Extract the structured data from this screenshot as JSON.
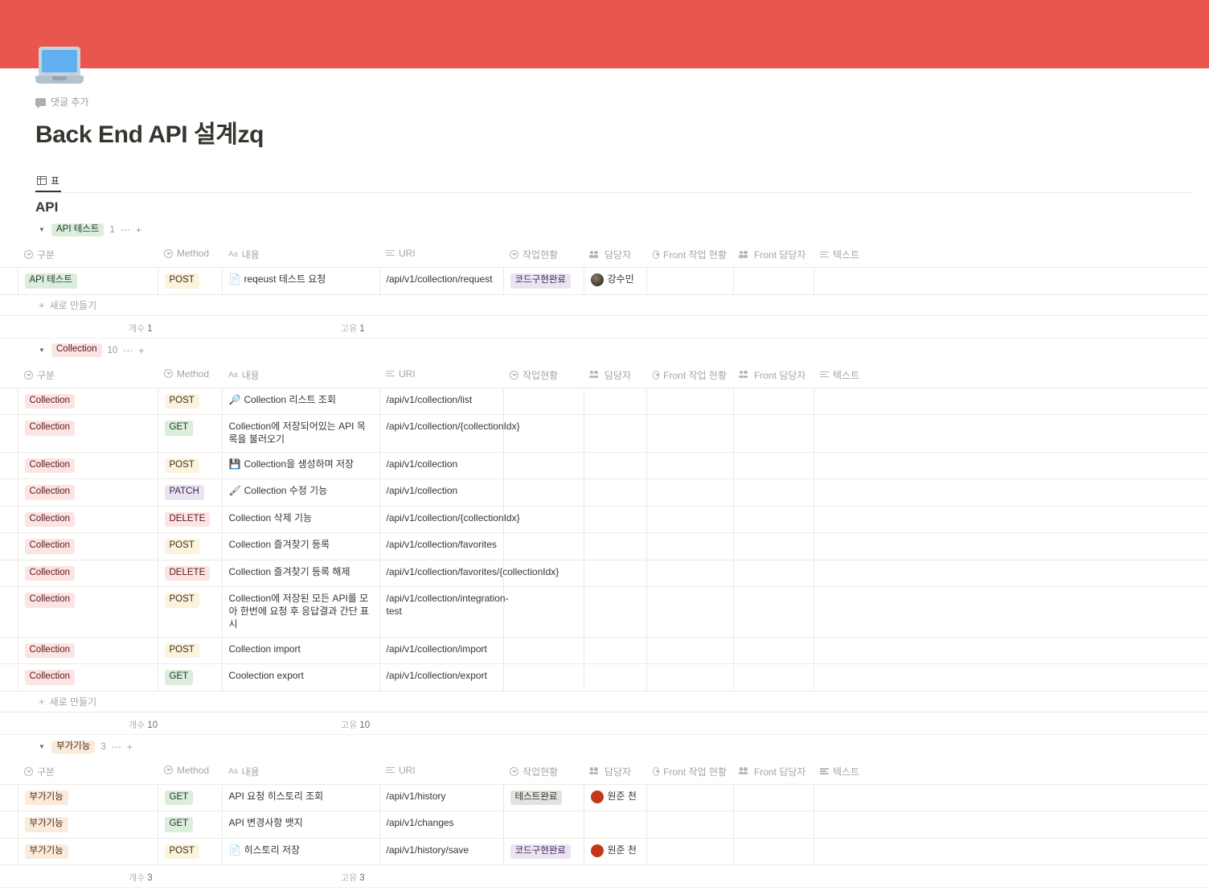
{
  "page": {
    "title": "Back End API 설계zq",
    "comment_add_label": "댓글 추가",
    "cover_color": "#e8564e",
    "icon_name": "laptop-icon"
  },
  "view_tabs": [
    {
      "label": "표",
      "icon": "grid-icon",
      "active": true
    }
  ],
  "database": {
    "title": "API",
    "columns": [
      {
        "key": "gubun",
        "label": "구분",
        "icon": "select-icon"
      },
      {
        "key": "method",
        "label": "Method",
        "icon": "select-icon"
      },
      {
        "key": "naeyong",
        "label": "내용",
        "icon": "aa-icon"
      },
      {
        "key": "uri",
        "label": "URI",
        "icon": "text-lines-icon"
      },
      {
        "key": "status",
        "label": "작업현황",
        "icon": "select-icon"
      },
      {
        "key": "owner",
        "label": "담당자",
        "icon": "people-icon"
      },
      {
        "key": "fstat",
        "label": "Front 작업 현황",
        "icon": "select-icon"
      },
      {
        "key": "fowner",
        "label": "Front 담당자",
        "icon": "people-icon"
      },
      {
        "key": "text",
        "label": "텍스트",
        "icon": "text-lines-icon"
      }
    ],
    "new_row_label": "새로 만들기",
    "summary_count_label": "개수",
    "summary_unique_label": "고유",
    "groups": [
      {
        "name": "API 테스트",
        "tag_style": "tag-green",
        "count": "1",
        "summary_count": "1",
        "summary_unique": "1",
        "rows": [
          {
            "gubun": "API 테스트",
            "gubun_style": "tag-green",
            "method": "POST",
            "method_style": "tag-yellow",
            "icon": "page-icon",
            "icon_glyph": "📄",
            "naeyong": "reqeust 테스트 요청",
            "uri": "/api/v1/collection/request",
            "status": "코드구현완료",
            "status_style": "tag-purple",
            "owner": "강수민",
            "owner_avatar": "av-photo",
            "fstat": "",
            "fowner": "",
            "text": ""
          }
        ]
      },
      {
        "name": "Collection",
        "tag_style": "tag-pink",
        "count": "10",
        "summary_count": "10",
        "summary_unique": "10",
        "rows": [
          {
            "gubun": "Collection",
            "gubun_style": "tag-pink",
            "method": "POST",
            "method_style": "tag-yellow",
            "icon": "magnifier-icon",
            "icon_glyph": "🔎",
            "naeyong": "Collection 리스트 조회",
            "uri": "/api/v1/collection/list",
            "status": "",
            "owner": "",
            "fstat": "",
            "fowner": "",
            "text": ""
          },
          {
            "gubun": "Collection",
            "gubun_style": "tag-pink",
            "method": "GET",
            "method_style": "tag-green",
            "icon": "",
            "icon_glyph": "",
            "naeyong": "Collection에 저장되어있는 API 목록을 불러오기",
            "uri": "/api/v1/collection/{collectionIdx}",
            "status": "",
            "owner": "",
            "fstat": "",
            "fowner": "",
            "text": ""
          },
          {
            "gubun": "Collection",
            "gubun_style": "tag-pink",
            "method": "POST",
            "method_style": "tag-yellow",
            "icon": "floppy-disk-icon",
            "icon_glyph": "💾",
            "naeyong": "Collection을 생성하며 저장",
            "uri": "/api/v1/collection",
            "status": "",
            "owner": "",
            "fstat": "",
            "fowner": "",
            "text": ""
          },
          {
            "gubun": "Collection",
            "gubun_style": "tag-pink",
            "method": "PATCH",
            "method_style": "tag-purple",
            "icon": "paintbrush-icon",
            "icon_glyph": "🖌",
            "naeyong": "Collection 수정 기능",
            "uri": "/api/v1/collection",
            "status": "",
            "owner": "",
            "fstat": "",
            "fowner": "",
            "text": ""
          },
          {
            "gubun": "Collection",
            "gubun_style": "tag-pink",
            "method": "DELETE",
            "method_style": "tag-pink",
            "icon": "",
            "icon_glyph": "",
            "naeyong": "Collection 삭제 기능",
            "uri": "/api/v1/collection/{collectionIdx}",
            "status": "",
            "owner": "",
            "fstat": "",
            "fowner": "",
            "text": ""
          },
          {
            "gubun": "Collection",
            "gubun_style": "tag-pink",
            "method": "POST",
            "method_style": "tag-yellow",
            "icon": "",
            "icon_glyph": "",
            "naeyong": "Collection 즐겨찾기 등록",
            "uri": "/api/v1/collection/favorites",
            "status": "",
            "owner": "",
            "fstat": "",
            "fowner": "",
            "text": ""
          },
          {
            "gubun": "Collection",
            "gubun_style": "tag-pink",
            "method": "DELETE",
            "method_style": "tag-pink",
            "icon": "",
            "icon_glyph": "",
            "naeyong": "Collection 즐겨찾기 등록 해제",
            "uri": "/api/v1/collection/favorites/{collectionIdx}",
            "status": "",
            "owner": "",
            "fstat": "",
            "fowner": "",
            "text": ""
          },
          {
            "gubun": "Collection",
            "gubun_style": "tag-pink",
            "method": "POST",
            "method_style": "tag-yellow",
            "icon": "",
            "icon_glyph": "",
            "naeyong": "Collection에 저장된 모든 API를 모아 한번에 요청 후 응답결과 간단 표시",
            "uri": "/api/v1/collection/integration-test",
            "status": "",
            "owner": "",
            "fstat": "",
            "fowner": "",
            "text": ""
          },
          {
            "gubun": "Collection",
            "gubun_style": "tag-pink",
            "method": "POST",
            "method_style": "tag-yellow",
            "icon": "",
            "icon_glyph": "",
            "naeyong": "Collection import",
            "uri": "/api/v1/collection/import",
            "status": "",
            "owner": "",
            "fstat": "",
            "fowner": "",
            "text": ""
          },
          {
            "gubun": "Collection",
            "gubun_style": "tag-pink",
            "method": "GET",
            "method_style": "tag-green",
            "icon": "",
            "icon_glyph": "",
            "naeyong": "Coolection export",
            "uri": "/api/v1/collection/export",
            "status": "",
            "owner": "",
            "fstat": "",
            "fowner": "",
            "text": ""
          }
        ]
      },
      {
        "name": "부가기능",
        "tag_style": "tag-orange",
        "count": "3",
        "summary_count": "3",
        "summary_unique": "3",
        "rows": [
          {
            "gubun": "부가기능",
            "gubun_style": "tag-orange",
            "method": "GET",
            "method_style": "tag-green",
            "icon": "",
            "icon_glyph": "",
            "naeyong": "API 요청 히스토리 조회",
            "uri": "/api/v1/history",
            "status": "테스트완료",
            "status_style": "tag-gray",
            "owner": "원준 천",
            "owner_avatar": "av-red",
            "fstat": "",
            "fowner": "",
            "text": ""
          },
          {
            "gubun": "부가기능",
            "gubun_style": "tag-orange",
            "method": "GET",
            "method_style": "tag-green",
            "icon": "",
            "icon_glyph": "",
            "naeyong": "API 변경사항 뱃지",
            "uri": "/api/v1/changes",
            "status": "",
            "owner": "",
            "fstat": "",
            "fowner": "",
            "text": ""
          },
          {
            "gubun": "부가기능",
            "gubun_style": "tag-orange",
            "method": "POST",
            "method_style": "tag-yellow",
            "icon": "page-icon",
            "icon_glyph": "📄",
            "naeyong": "히스토리 저장",
            "uri": "/api/v1/history/save",
            "status": "코드구현완료",
            "status_style": "tag-purple",
            "owner": "원준 천",
            "owner_avatar": "av-red",
            "fstat": "",
            "fowner": "",
            "text": ""
          }
        ]
      }
    ]
  }
}
